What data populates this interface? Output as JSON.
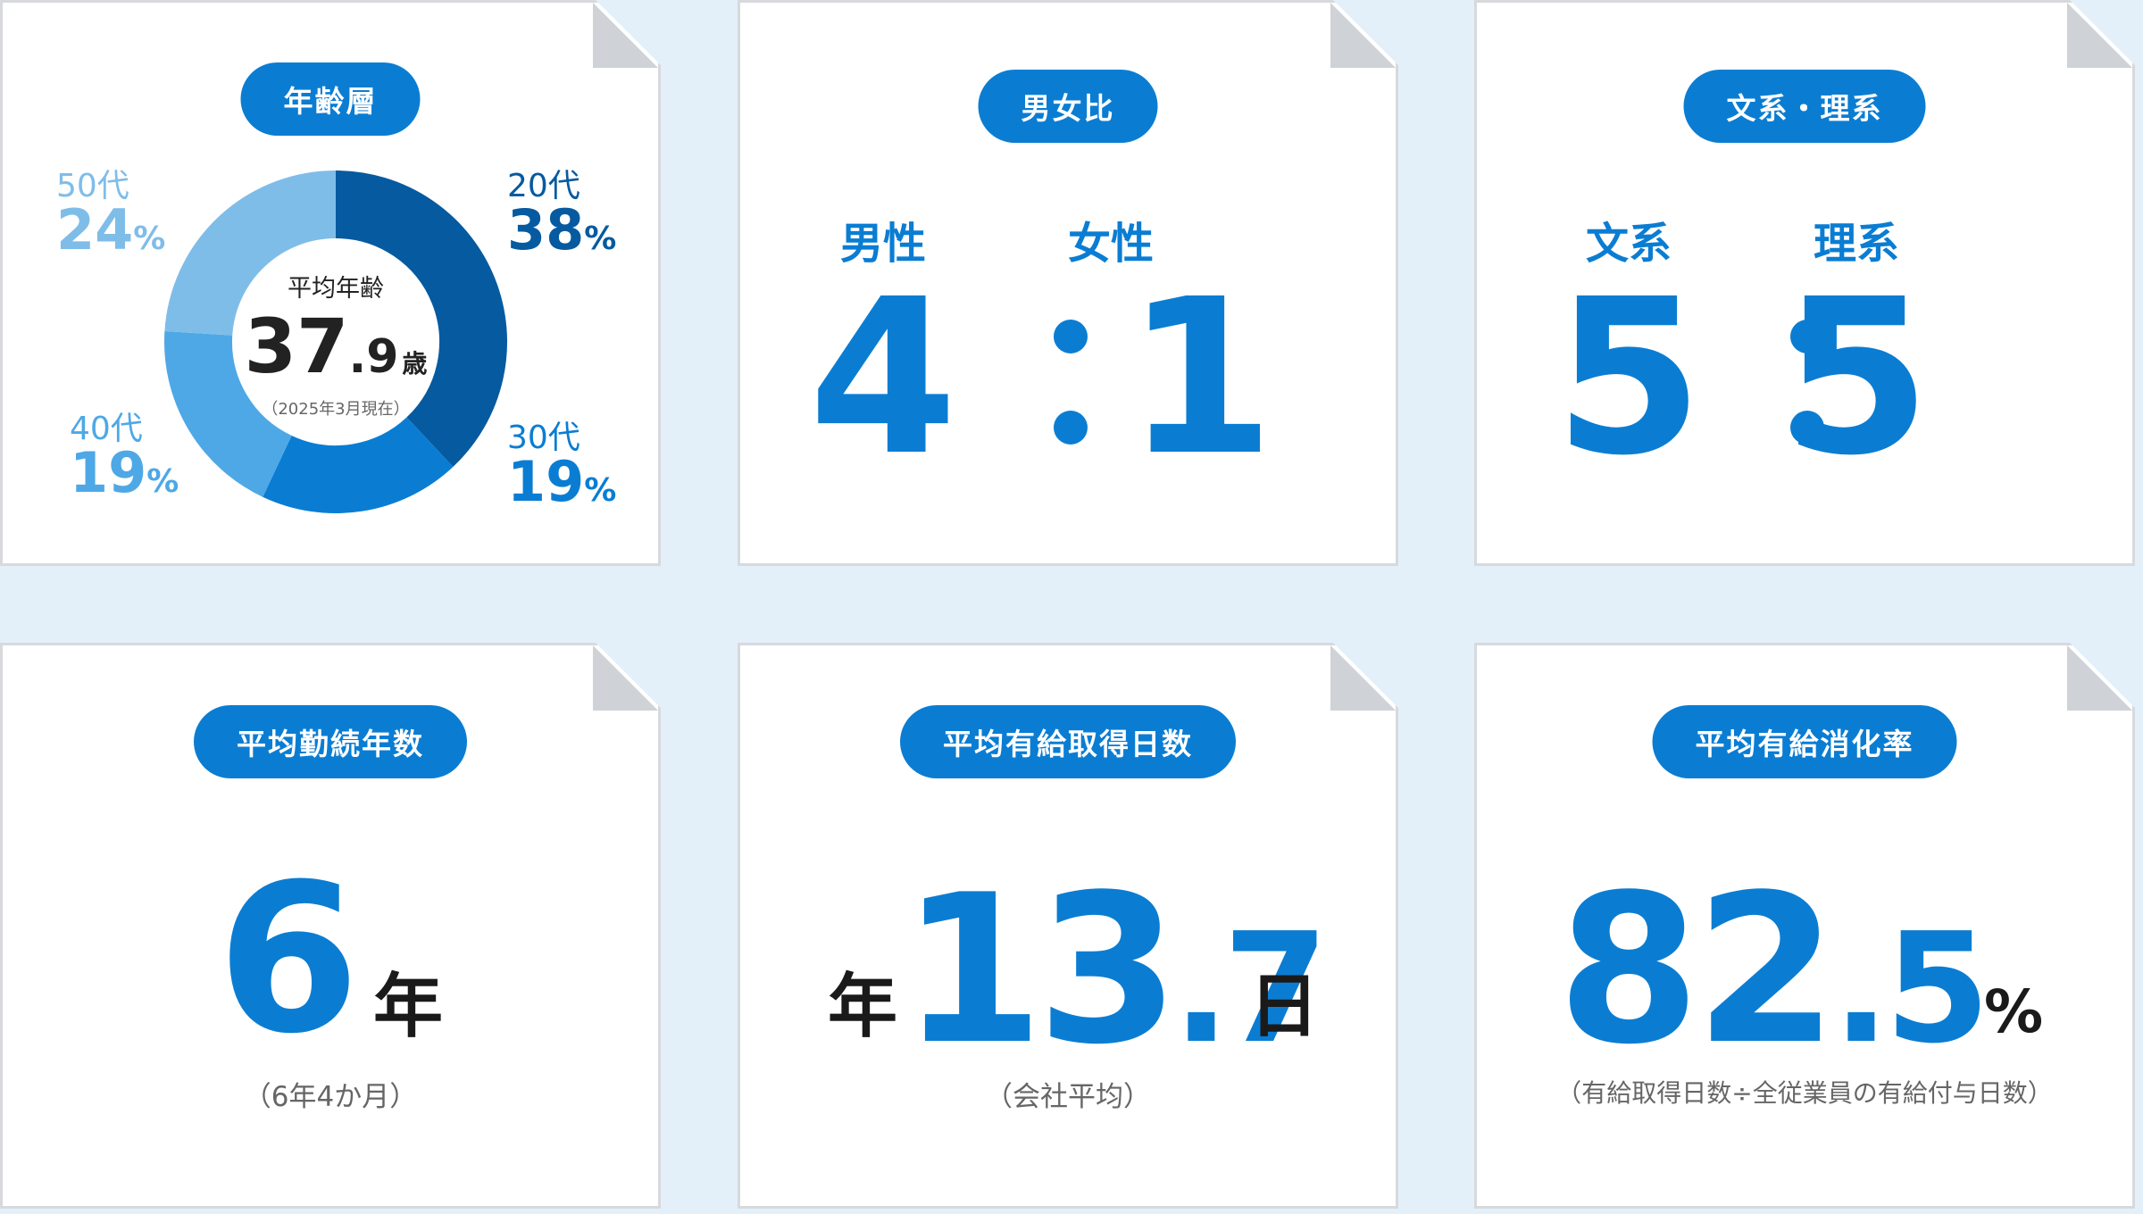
{
  "cards": {
    "age": {
      "title": "年齢層",
      "center_label": "平均年齢",
      "center_value_int": "37",
      "center_value_dec": ".9",
      "center_unit": "歳",
      "center_note": "（2025年3月現在）"
    },
    "gender": {
      "title": "男女比",
      "left_label": "男性",
      "right_label": "女性",
      "left_value": "4",
      "right_value": "1"
    },
    "major": {
      "title": "文系・理系",
      "left_label": "文系",
      "right_label": "理系",
      "left_value": "5",
      "right_value": "5"
    },
    "tenure": {
      "title": "平均勤続年数",
      "value": "6",
      "unit": "年",
      "note": "（6年4か月）"
    },
    "leave_days": {
      "title": "平均有給取得日数",
      "prefix": "年",
      "value_int": "13",
      "value_dec": ".7",
      "unit": "日",
      "note": "（会社平均）"
    },
    "leave_rate": {
      "title": "平均有給消化率",
      "value_int": "82",
      "value_dec": ".5",
      "unit": "%",
      "note": "（有給取得日数÷全従業員の有給付与日数）"
    }
  },
  "chart_data": {
    "type": "pie",
    "categories": [
      "20代",
      "30代",
      "40代",
      "50代"
    ],
    "values": [
      38,
      19,
      19,
      24
    ],
    "value_labels": [
      "38",
      "19",
      "19",
      "24"
    ],
    "unit": "%",
    "colors": [
      "#065aa0",
      "#0a7dd3",
      "#4ea8e6",
      "#7fbde9"
    ]
  }
}
